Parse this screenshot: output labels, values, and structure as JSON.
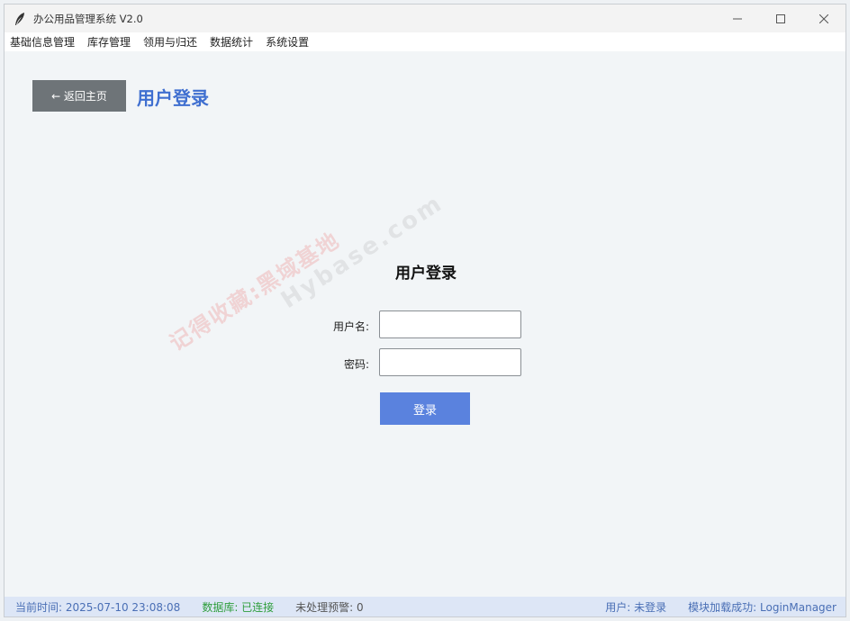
{
  "window": {
    "title": "办公用品管理系统 V2.0"
  },
  "menu": {
    "items": [
      "基础信息管理",
      "库存管理",
      "领用与归还",
      "数据统计",
      "系统设置"
    ]
  },
  "page": {
    "back_label": "← 返回主页",
    "title": "用户登录"
  },
  "login": {
    "heading": "用户登录",
    "username_label": "用户名:",
    "username_value": "",
    "password_label": "密码:",
    "password_value": "",
    "submit_label": "登录"
  },
  "watermark": {
    "line1": "记得收藏:黑域基地",
    "line2": "Hybase.com"
  },
  "status": {
    "time": "当前时间: 2025-07-10 23:08:08",
    "database": "数据库: 已连接",
    "alerts": "未处理预警: 0",
    "user": "用户: 未登录",
    "module": "模块加载成功: LoginManager"
  },
  "colors": {
    "accent": "#3f6fd0",
    "login_button": "#5a82de",
    "back_button": "#6e7478",
    "status_ok": "#2e9e3c",
    "status_text": "#4a6fb5"
  }
}
